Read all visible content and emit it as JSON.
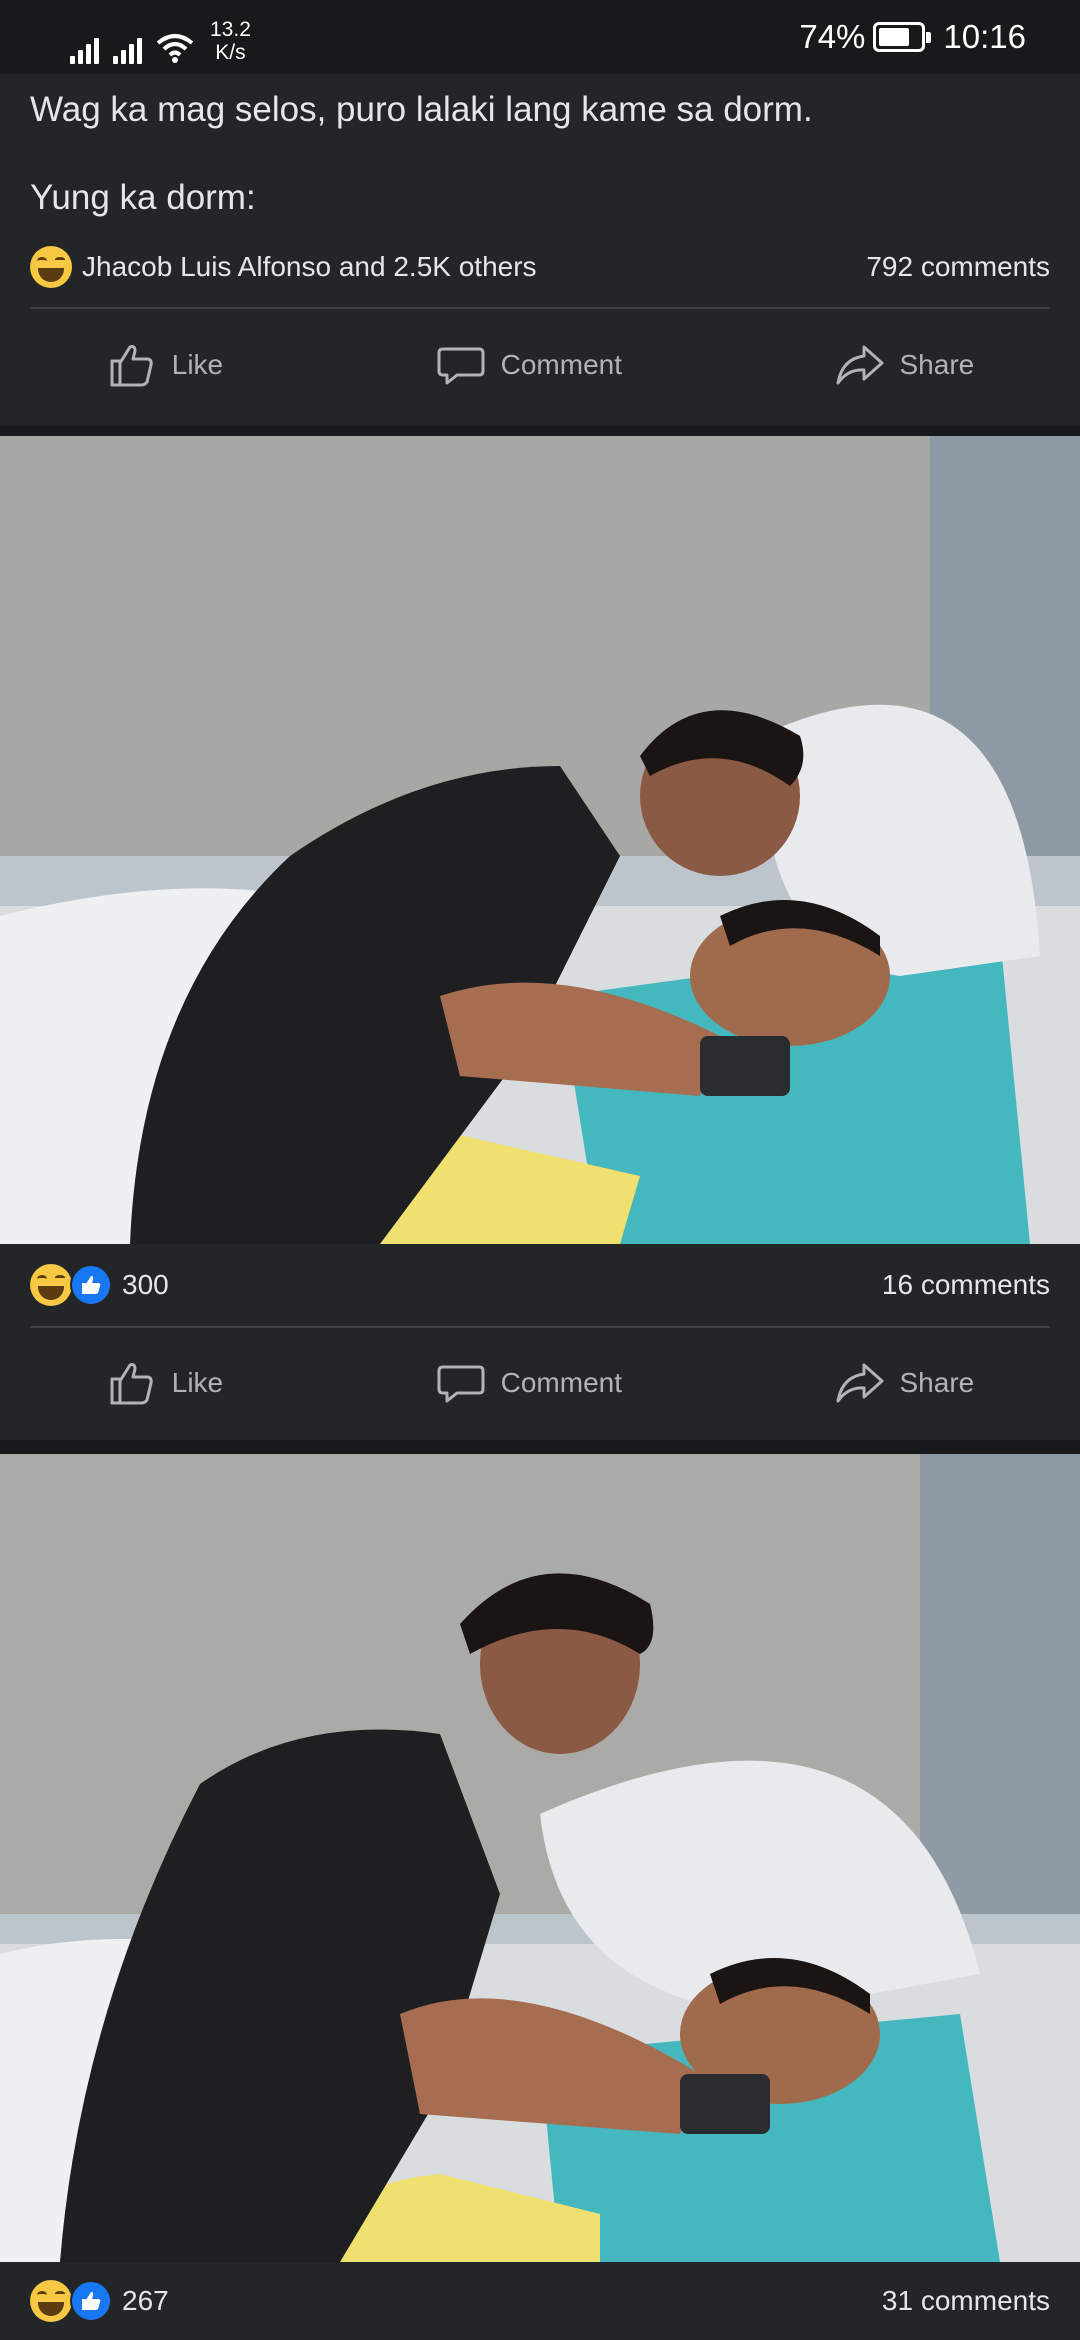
{
  "status_bar": {
    "net_speed_value": "13.2",
    "net_speed_unit": "K/s",
    "battery": "74%",
    "battery_level": 0.74,
    "time": "10:16"
  },
  "post": {
    "line1": "Wag ka mag selos, puro lalaki lang kame sa dorm.",
    "line2": "Yung ka dorm:",
    "reactions_text": "Jhacob Luis Alfonso and 2.5K others",
    "comments": "792 comments"
  },
  "photo1": {
    "reaction_count": "300",
    "comments": "16 comments"
  },
  "photo2": {
    "reaction_count": "267",
    "comments": "31 comments"
  },
  "actions": {
    "like": "Like",
    "comment": "Comment",
    "share": "Share"
  },
  "icons": {
    "like": "thumbs-up-icon",
    "comment": "speech-bubble-icon",
    "share": "share-arrow-icon",
    "haha": "haha-reaction-icon",
    "like_reaction": "like-reaction-icon"
  }
}
